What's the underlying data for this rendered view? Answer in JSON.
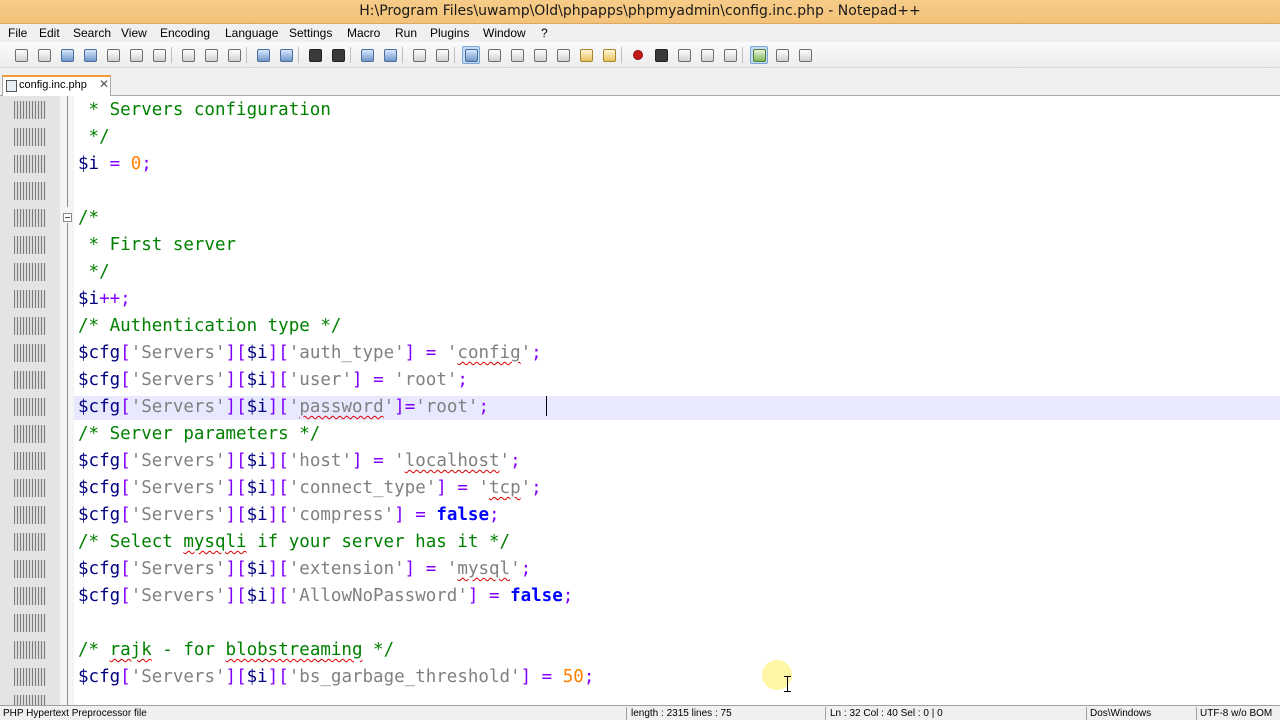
{
  "window": {
    "title": "H:\\Program Files\\uwamp\\Old\\phpapps\\phpmyadmin\\config.inc.php - Notepad++"
  },
  "menu": {
    "items": [
      "File",
      "Edit",
      "Search",
      "View",
      "Encoding",
      "Language",
      "Settings",
      "Macro",
      "Run",
      "Plugins",
      "Window",
      "?"
    ]
  },
  "toolbar": {
    "buttons": [
      "new-icon",
      "open-icon",
      "save-icon",
      "save-all-icon",
      "close-icon",
      "close-all-icon",
      "print-icon",
      "cut-icon",
      "copy-icon",
      "paste-icon",
      "undo-icon",
      "redo-icon",
      "find-icon",
      "replace-icon",
      "zoom-in-icon",
      "zoom-out-icon",
      "sync-vertical-icon",
      "sync-horizontal-icon",
      "word-wrap-icon",
      "show-all-chars-icon",
      "indent-guide-icon",
      "user-lang-icon",
      "doc-map-icon",
      "function-list-icon",
      "folder-workspace-icon",
      "record-macro-icon",
      "stop-macro-icon",
      "play-macro-icon",
      "run-macro-multiple-icon",
      "save-macro-icon",
      "spell-check-icon",
      "spell-next-icon",
      "spell-settings-icon"
    ]
  },
  "tabs": [
    {
      "label": "config.inc.php",
      "active": true
    }
  ],
  "editor": {
    "lines": [
      [
        {
          "t": " * Servers configuration",
          "c": "c-comment"
        }
      ],
      [
        {
          "t": " */",
          "c": "c-comment"
        }
      ],
      [
        {
          "t": "$i",
          "c": "c-var"
        },
        {
          "t": " ",
          "c": "c-plain"
        },
        {
          "t": "=",
          "c": "c-op"
        },
        {
          "t": " ",
          "c": "c-plain"
        },
        {
          "t": "0",
          "c": "c-num"
        },
        {
          "t": ";",
          "c": "c-op"
        }
      ],
      [],
      [
        {
          "t": "/*",
          "c": "c-comment"
        }
      ],
      [
        {
          "t": " * First server",
          "c": "c-comment"
        }
      ],
      [
        {
          "t": " */",
          "c": "c-comment"
        }
      ],
      [
        {
          "t": "$i",
          "c": "c-var"
        },
        {
          "t": "++;",
          "c": "c-op"
        }
      ],
      [
        {
          "t": "/* Authentication type */",
          "c": "c-comment"
        }
      ],
      [
        {
          "t": "$cfg",
          "c": "c-var"
        },
        {
          "t": "[",
          "c": "c-op"
        },
        {
          "t": "'Servers'",
          "c": "c-str"
        },
        {
          "t": "][",
          "c": "c-op"
        },
        {
          "t": "$i",
          "c": "c-var"
        },
        {
          "t": "][",
          "c": "c-op"
        },
        {
          "t": "'auth_type'",
          "c": "c-str"
        },
        {
          "t": "]",
          "c": "c-op"
        },
        {
          "t": " ",
          "c": "c-plain"
        },
        {
          "t": "=",
          "c": "c-op"
        },
        {
          "t": " ",
          "c": "c-plain"
        },
        {
          "t": "'",
          "c": "c-str"
        },
        {
          "t": "config",
          "c": "c-str squiggle"
        },
        {
          "t": "'",
          "c": "c-str"
        },
        {
          "t": ";",
          "c": "c-op"
        }
      ],
      [
        {
          "t": "$cfg",
          "c": "c-var"
        },
        {
          "t": "[",
          "c": "c-op"
        },
        {
          "t": "'Servers'",
          "c": "c-str"
        },
        {
          "t": "][",
          "c": "c-op"
        },
        {
          "t": "$i",
          "c": "c-var"
        },
        {
          "t": "][",
          "c": "c-op"
        },
        {
          "t": "'user'",
          "c": "c-str"
        },
        {
          "t": "]",
          "c": "c-op"
        },
        {
          "t": " ",
          "c": "c-plain"
        },
        {
          "t": "=",
          "c": "c-op"
        },
        {
          "t": " ",
          "c": "c-plain"
        },
        {
          "t": "'root'",
          "c": "c-str"
        },
        {
          "t": ";",
          "c": "c-op"
        }
      ],
      [
        {
          "t": "$cfg",
          "c": "c-var"
        },
        {
          "t": "[",
          "c": "c-op"
        },
        {
          "t": "'Servers'",
          "c": "c-str"
        },
        {
          "t": "][",
          "c": "c-op"
        },
        {
          "t": "$i",
          "c": "c-var"
        },
        {
          "t": "][",
          "c": "c-op"
        },
        {
          "t": "'",
          "c": "c-str"
        },
        {
          "t": "password",
          "c": "c-str squiggle"
        },
        {
          "t": "'",
          "c": "c-str"
        },
        {
          "t": "]=",
          "c": "c-op"
        },
        {
          "t": "'root'",
          "c": "c-str"
        },
        {
          "t": ";",
          "c": "c-op"
        }
      ],
      [
        {
          "t": "/* Server parameters */",
          "c": "c-comment"
        }
      ],
      [
        {
          "t": "$cfg",
          "c": "c-var"
        },
        {
          "t": "[",
          "c": "c-op"
        },
        {
          "t": "'Servers'",
          "c": "c-str"
        },
        {
          "t": "][",
          "c": "c-op"
        },
        {
          "t": "$i",
          "c": "c-var"
        },
        {
          "t": "][",
          "c": "c-op"
        },
        {
          "t": "'host'",
          "c": "c-str"
        },
        {
          "t": "]",
          "c": "c-op"
        },
        {
          "t": " ",
          "c": "c-plain"
        },
        {
          "t": "=",
          "c": "c-op"
        },
        {
          "t": " ",
          "c": "c-plain"
        },
        {
          "t": "'",
          "c": "c-str"
        },
        {
          "t": "localhost",
          "c": "c-str squiggle"
        },
        {
          "t": "'",
          "c": "c-str"
        },
        {
          "t": ";",
          "c": "c-op"
        }
      ],
      [
        {
          "t": "$cfg",
          "c": "c-var"
        },
        {
          "t": "[",
          "c": "c-op"
        },
        {
          "t": "'Servers'",
          "c": "c-str"
        },
        {
          "t": "][",
          "c": "c-op"
        },
        {
          "t": "$i",
          "c": "c-var"
        },
        {
          "t": "][",
          "c": "c-op"
        },
        {
          "t": "'connect_type'",
          "c": "c-str"
        },
        {
          "t": "]",
          "c": "c-op"
        },
        {
          "t": " ",
          "c": "c-plain"
        },
        {
          "t": "=",
          "c": "c-op"
        },
        {
          "t": " ",
          "c": "c-plain"
        },
        {
          "t": "'",
          "c": "c-str"
        },
        {
          "t": "tcp",
          "c": "c-str squiggle"
        },
        {
          "t": "'",
          "c": "c-str"
        },
        {
          "t": ";",
          "c": "c-op"
        }
      ],
      [
        {
          "t": "$cfg",
          "c": "c-var"
        },
        {
          "t": "[",
          "c": "c-op"
        },
        {
          "t": "'Servers'",
          "c": "c-str"
        },
        {
          "t": "][",
          "c": "c-op"
        },
        {
          "t": "$i",
          "c": "c-var"
        },
        {
          "t": "][",
          "c": "c-op"
        },
        {
          "t": "'compress'",
          "c": "c-str"
        },
        {
          "t": "]",
          "c": "c-op"
        },
        {
          "t": " ",
          "c": "c-plain"
        },
        {
          "t": "=",
          "c": "c-op"
        },
        {
          "t": " ",
          "c": "c-plain"
        },
        {
          "t": "false",
          "c": "c-kw"
        },
        {
          "t": ";",
          "c": "c-op"
        }
      ],
      [
        {
          "t": "/* Select ",
          "c": "c-comment"
        },
        {
          "t": "mysqli",
          "c": "c-comment squiggle"
        },
        {
          "t": " if your server has it */",
          "c": "c-comment"
        }
      ],
      [
        {
          "t": "$cfg",
          "c": "c-var"
        },
        {
          "t": "[",
          "c": "c-op"
        },
        {
          "t": "'Servers'",
          "c": "c-str"
        },
        {
          "t": "][",
          "c": "c-op"
        },
        {
          "t": "$i",
          "c": "c-var"
        },
        {
          "t": "][",
          "c": "c-op"
        },
        {
          "t": "'extension'",
          "c": "c-str"
        },
        {
          "t": "]",
          "c": "c-op"
        },
        {
          "t": " ",
          "c": "c-plain"
        },
        {
          "t": "=",
          "c": "c-op"
        },
        {
          "t": " ",
          "c": "c-plain"
        },
        {
          "t": "'",
          "c": "c-str"
        },
        {
          "t": "mysql",
          "c": "c-str squiggle"
        },
        {
          "t": "'",
          "c": "c-str"
        },
        {
          "t": ";",
          "c": "c-op"
        }
      ],
      [
        {
          "t": "$cfg",
          "c": "c-var"
        },
        {
          "t": "[",
          "c": "c-op"
        },
        {
          "t": "'Servers'",
          "c": "c-str"
        },
        {
          "t": "][",
          "c": "c-op"
        },
        {
          "t": "$i",
          "c": "c-var"
        },
        {
          "t": "][",
          "c": "c-op"
        },
        {
          "t": "'AllowNoPassword'",
          "c": "c-str"
        },
        {
          "t": "]",
          "c": "c-op"
        },
        {
          "t": " ",
          "c": "c-plain"
        },
        {
          "t": "=",
          "c": "c-op"
        },
        {
          "t": " ",
          "c": "c-plain"
        },
        {
          "t": "false",
          "c": "c-kw"
        },
        {
          "t": ";",
          "c": "c-op"
        }
      ],
      [],
      [
        {
          "t": "/* ",
          "c": "c-comment"
        },
        {
          "t": "rajk",
          "c": "c-comment squiggle"
        },
        {
          "t": " - for ",
          "c": "c-comment"
        },
        {
          "t": "blobstreaming",
          "c": "c-comment squiggle"
        },
        {
          "t": " */",
          "c": "c-comment"
        }
      ],
      [
        {
          "t": "$cfg",
          "c": "c-var"
        },
        {
          "t": "[",
          "c": "c-op"
        },
        {
          "t": "'Servers'",
          "c": "c-str"
        },
        {
          "t": "][",
          "c": "c-op"
        },
        {
          "t": "$i",
          "c": "c-var"
        },
        {
          "t": "][",
          "c": "c-op"
        },
        {
          "t": "'bs_garbage_threshold'",
          "c": "c-str"
        },
        {
          "t": "]",
          "c": "c-op"
        },
        {
          "t": " ",
          "c": "c-plain"
        },
        {
          "t": "=",
          "c": "c-op"
        },
        {
          "t": " ",
          "c": "c-plain"
        },
        {
          "t": "50",
          "c": "c-num"
        },
        {
          "t": ";",
          "c": "c-op"
        }
      ]
    ],
    "current_line_index": 11,
    "fold_markers": [
      4
    ]
  },
  "status": {
    "file_type": "PHP Hypertext Preprocessor file",
    "length_lines": "length : 2315    lines : 75",
    "position": "Ln : 32    Col : 40    Sel : 0 | 0",
    "eol": "Dos\\Windows",
    "encoding": "UTF-8 w/o BOM"
  }
}
